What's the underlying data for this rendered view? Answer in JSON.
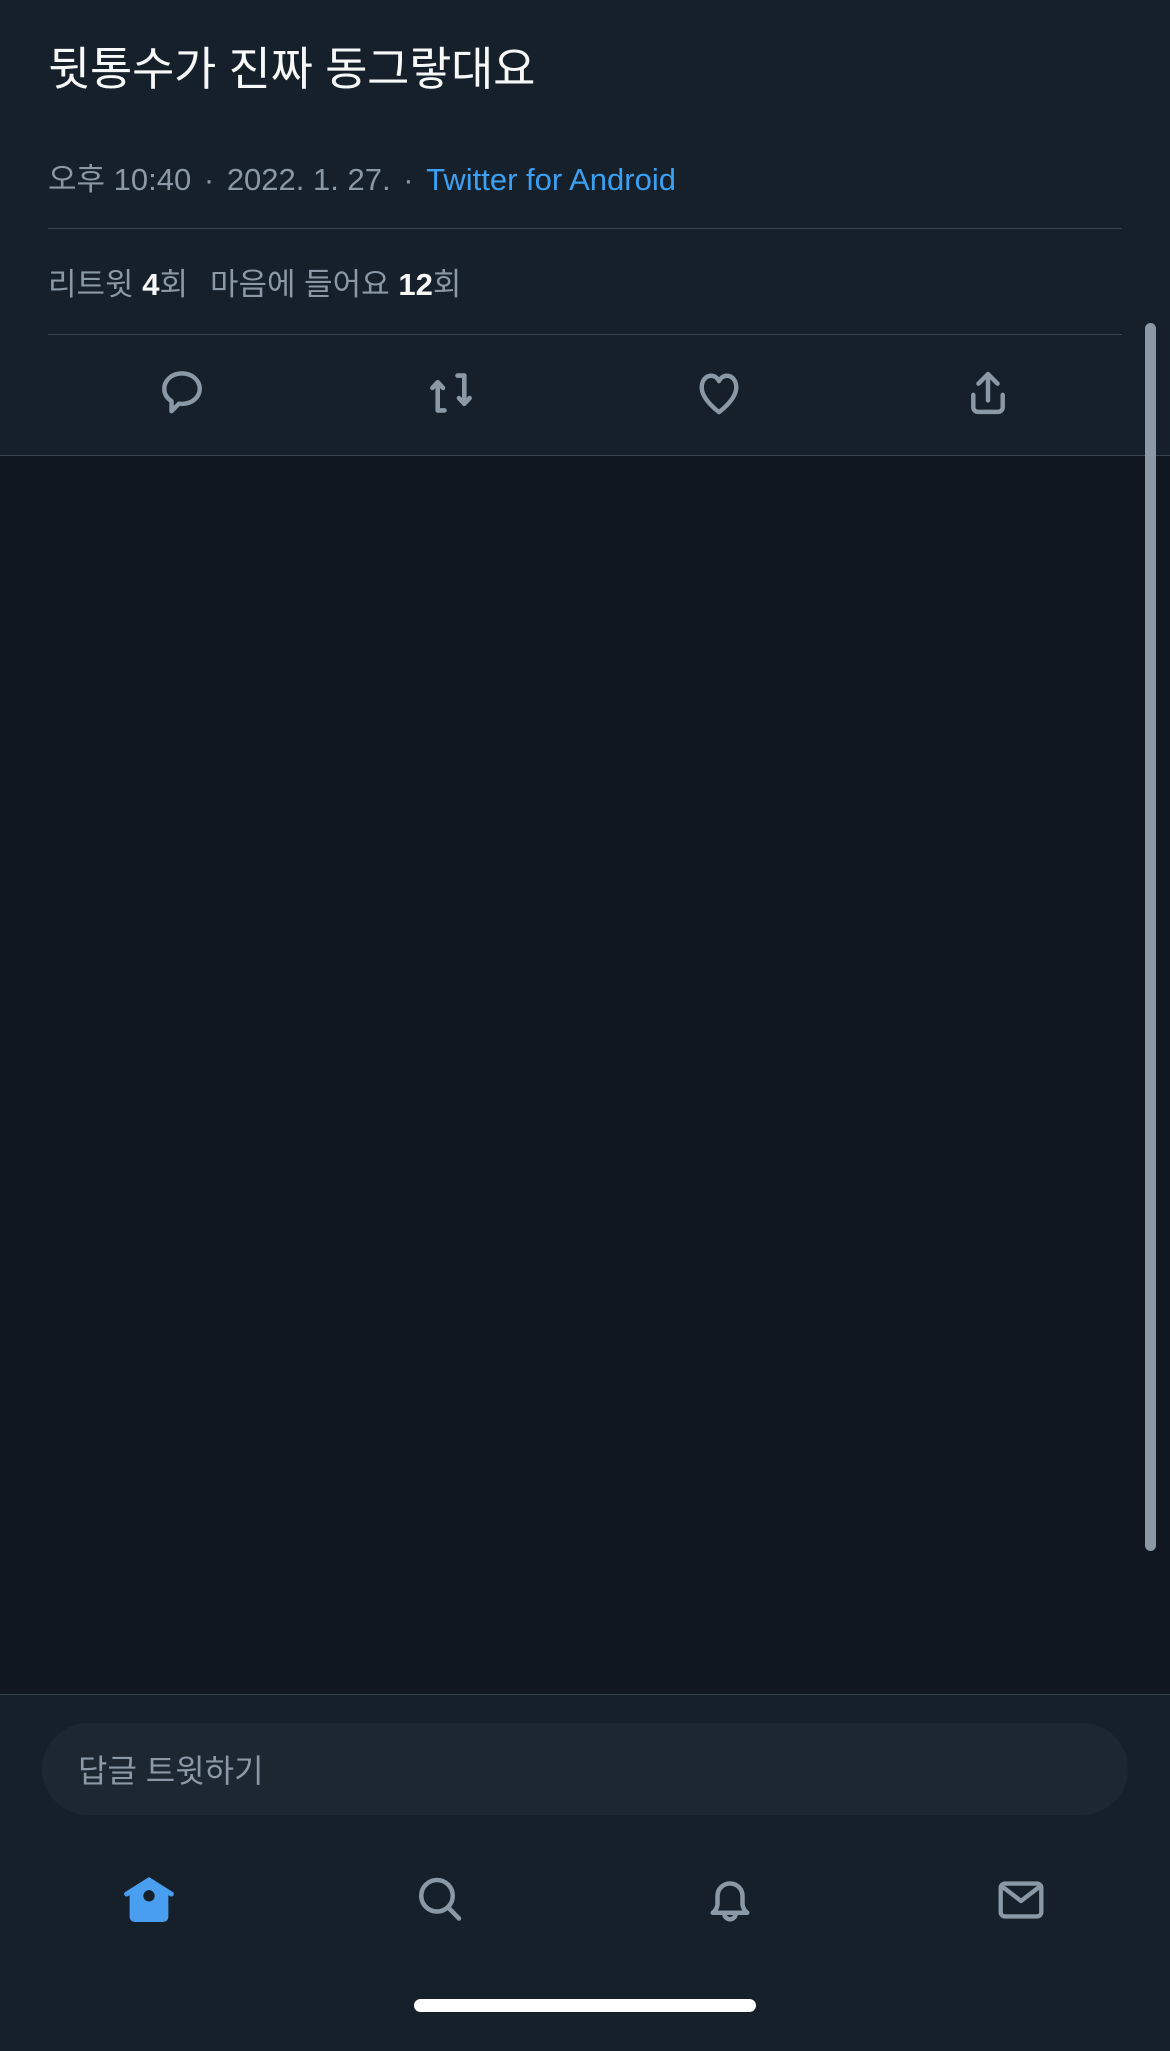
{
  "theme": {
    "background": "#15202b",
    "empty_background": "#101721",
    "divider": "#38444d",
    "primary_text": "#f7f9f9",
    "secondary_text": "#8b98a5",
    "link": "#3ba0f1",
    "accent": "#4a9ef0",
    "composer_background": "#1c2732"
  },
  "tweet": {
    "text": "뒷통수가 진짜 동그랗대요",
    "meta": {
      "time": "오후 10:40",
      "separator_1": "·",
      "date": "2022. 1. 27.",
      "separator_2": "·",
      "source": "Twitter for Android"
    },
    "stats": {
      "retweet_label": "리트윗",
      "retweet_count": "4",
      "retweet_unit": "회",
      "like_label": "마음에 들어요",
      "like_count": "12",
      "like_unit": "회"
    },
    "actions": [
      {
        "name": "reply",
        "icon": "comment-icon"
      },
      {
        "name": "retweet",
        "icon": "retweet-icon"
      },
      {
        "name": "like",
        "icon": "heart-icon"
      },
      {
        "name": "share",
        "icon": "share-icon"
      }
    ]
  },
  "composer": {
    "placeholder": "답글 트윗하기"
  },
  "bottom_nav": {
    "items": [
      {
        "name": "home",
        "icon": "home-icon",
        "active": true
      },
      {
        "name": "search",
        "icon": "search-icon",
        "active": false
      },
      {
        "name": "notifications",
        "icon": "bell-icon",
        "active": false
      },
      {
        "name": "messages",
        "icon": "envelope-icon",
        "active": false
      }
    ]
  },
  "system": {
    "home_indicator": "home-indicator-bar"
  }
}
